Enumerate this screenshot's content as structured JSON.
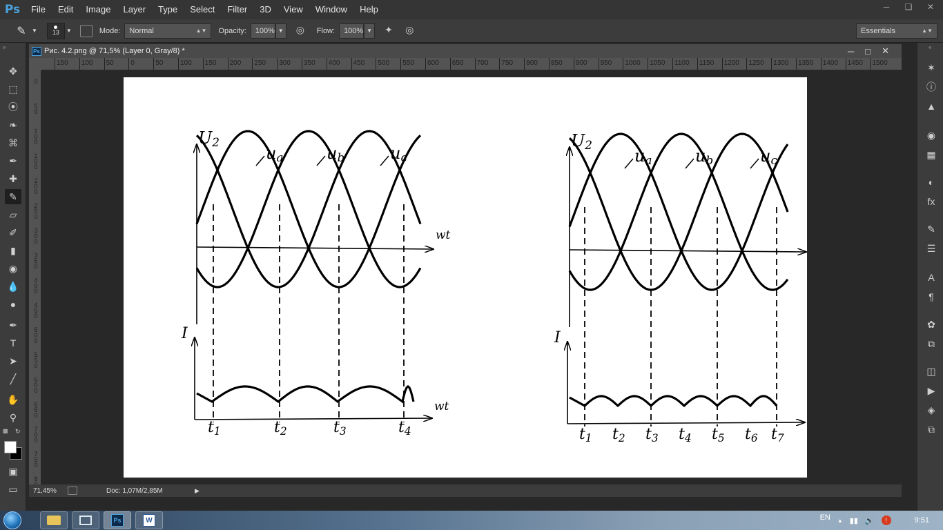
{
  "app": {
    "logo": "Ps"
  },
  "menu": [
    "File",
    "Edit",
    "Image",
    "Layer",
    "Type",
    "Select",
    "Filter",
    "3D",
    "View",
    "Window",
    "Help"
  ],
  "options": {
    "brush_size": "13",
    "mode_label": "Mode:",
    "mode_value": "Normal",
    "opacity_label": "Opacity:",
    "opacity_value": "100%",
    "flow_label": "Flow:",
    "flow_value": "100%",
    "workspace": "Essentials"
  },
  "document": {
    "title": "Рис. 4.2.png @ 71,5% (Layer 0, Gray/8) *",
    "zoom": "71,45%",
    "doc_info": "Doc: 1,07M/2,85M"
  },
  "ruler": {
    "top_labels": [
      "150",
      "100",
      "50",
      "0",
      "50",
      "100",
      "150",
      "200",
      "250",
      "300",
      "350",
      "400",
      "450",
      "500",
      "550",
      "600",
      "650",
      "700",
      "750",
      "800",
      "850",
      "900",
      "950",
      "1000",
      "1050",
      "1100",
      "1150",
      "1200",
      "1250",
      "1300",
      "1350",
      "1400",
      "1450",
      "1500"
    ],
    "left_labels": [
      "0",
      "50",
      "100",
      "150",
      "200",
      "250",
      "300",
      "350",
      "400",
      "450",
      "500",
      "550",
      "600",
      "650",
      "700",
      "750",
      "800"
    ]
  },
  "figure": {
    "left": {
      "y_top": "U",
      "y_top_sub": "2",
      "y_bottom": "I",
      "x_label": "wt",
      "curves": [
        {
          "main": "u",
          "sub": "a"
        },
        {
          "main": "u",
          "sub": "b"
        },
        {
          "main": "u",
          "sub": "c"
        }
      ],
      "t_labels": [
        {
          "main": "t",
          "sub": "1"
        },
        {
          "main": "t",
          "sub": "2"
        },
        {
          "main": "t",
          "sub": "3"
        },
        {
          "main": "t",
          "sub": "4"
        }
      ]
    },
    "right": {
      "y_top": "U",
      "y_top_sub": "2",
      "y_bottom": "I",
      "x_label": "wt",
      "curves": [
        {
          "main": "u",
          "sub": "a"
        },
        {
          "main": "u",
          "sub": "b"
        },
        {
          "main": "u",
          "sub": "c"
        }
      ],
      "t_labels": [
        {
          "main": "t",
          "sub": "1"
        },
        {
          "main": "t",
          "sub": "2"
        },
        {
          "main": "t",
          "sub": "3"
        },
        {
          "main": "t",
          "sub": "4"
        },
        {
          "main": "t",
          "sub": "5"
        },
        {
          "main": "t",
          "sub": "6"
        },
        {
          "main": "t",
          "sub": "7"
        }
      ]
    }
  },
  "taskbar": {
    "lang": "EN",
    "time": "9:51",
    "apps": [
      "explorer",
      "window-switcher",
      "photoshop",
      "word"
    ]
  }
}
